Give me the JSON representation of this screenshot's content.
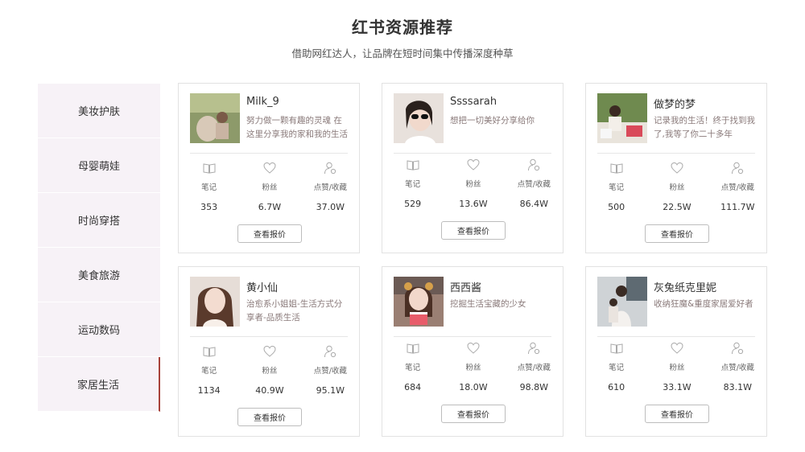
{
  "header": {
    "title": "红书资源推荐",
    "subtitle": "借助网红达人，让品牌在短时间集中传播深度种草"
  },
  "sidebar": {
    "items": [
      {
        "label": "美妆护肤"
      },
      {
        "label": "母婴萌娃"
      },
      {
        "label": "时尚穿搭"
      },
      {
        "label": "美食旅游"
      },
      {
        "label": "运动数码"
      },
      {
        "label": "家居生活"
      }
    ],
    "active_index": 5
  },
  "labels": {
    "notes": "笔记",
    "fans": "粉丝",
    "likes": "点赞/收藏",
    "quote_button": "查看报价"
  },
  "icons": {
    "notes": "book-icon",
    "fans": "heart-icon",
    "likes": "user-star-icon"
  },
  "colors": {
    "accent": "#a8423a",
    "sidebar_bg": "#f7f2f7"
  },
  "cards": [
    {
      "name": "Milk_9",
      "desc": "努力做一颗有趣的灵魂 在这里分享我的家和我的生活",
      "notes": "353",
      "fans": "6.7W",
      "likes": "37.0W"
    },
    {
      "name": "Ssssarah",
      "desc": "想把一切美好分享给你",
      "notes": "529",
      "fans": "13.6W",
      "likes": "86.4W"
    },
    {
      "name": "做梦的梦",
      "desc": "记录我的生活！终于找到我了,我等了你二十多年哎！...",
      "notes": "500",
      "fans": "22.5W",
      "likes": "111.7W"
    },
    {
      "name": "黄小仙",
      "desc": "治愈系小姐姐-生活方式分享者-品质生活",
      "notes": "1134",
      "fans": "40.9W",
      "likes": "95.1W"
    },
    {
      "name": "西西酱",
      "desc": "挖掘生活宝藏的少女",
      "notes": "684",
      "fans": "18.0W",
      "likes": "98.8W"
    },
    {
      "name": "灰兔纸克里妮",
      "desc": "收纳狂魔&重度家居爱好者",
      "notes": "610",
      "fans": "33.1W",
      "likes": "83.1W"
    }
  ]
}
